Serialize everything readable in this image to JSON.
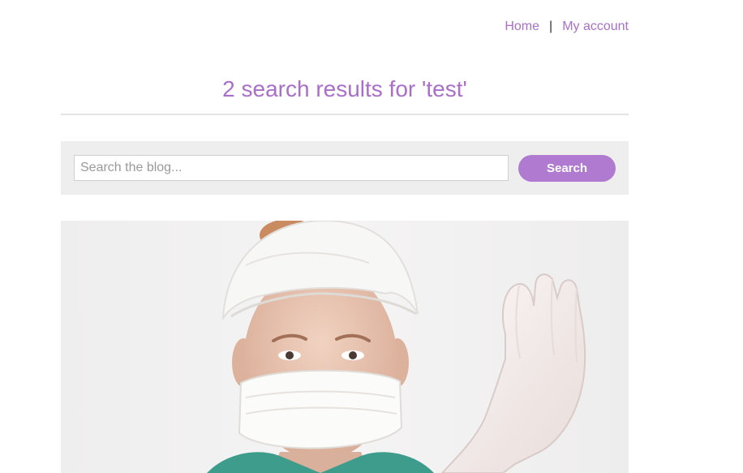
{
  "header": {
    "nav": {
      "home_label": "Home",
      "separator": "|",
      "account_label": "My account"
    }
  },
  "main": {
    "title": "2 search results for 'test'",
    "search": {
      "placeholder": "Search the blog...",
      "value": "",
      "button_label": "Search"
    },
    "featured_image": {
      "alt": "",
      "subject": "person in surgical cap, face mask and gloves"
    }
  },
  "colors": {
    "accent": "#a96fc9",
    "button": "#b07ad1",
    "panel": "#eeeeee",
    "rule": "#e3e3e3"
  }
}
